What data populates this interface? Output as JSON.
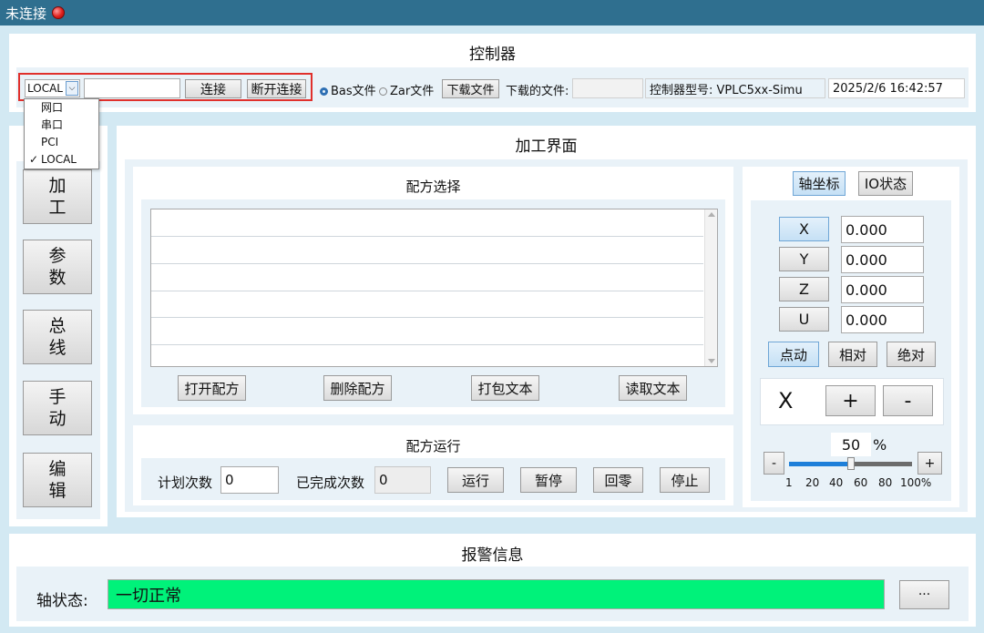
{
  "window": {
    "title": "未连接"
  },
  "controller": {
    "title": "控制器",
    "connection_type": "LOCAL",
    "address_value": "",
    "connect_label": "连接",
    "disconnect_label": "断开连接",
    "bas_label": "Bas文件",
    "zar_label": "Zar文件",
    "download_file_label": "下载文件",
    "downloaded_file_label": "下载的文件:",
    "downloaded_file_value": "",
    "model_label": "控制器型号: VPLC5xx-Simu",
    "datetime": "2025/2/6 16:42:57",
    "dropdown_options": [
      "网口",
      "串口",
      "PCI",
      "LOCAL"
    ],
    "dropdown_checked": "✓"
  },
  "sidebar": {
    "items": [
      {
        "line1": "加",
        "line2": "工"
      },
      {
        "line1": "参",
        "line2": "数"
      },
      {
        "line1": "总",
        "line2": "线"
      },
      {
        "line1": "手",
        "line2": "动"
      },
      {
        "line1": "编",
        "line2": "辑"
      }
    ]
  },
  "processing": {
    "title": "加工界面",
    "recipe_select": {
      "title": "配方选择",
      "open": "打开配方",
      "delete": "删除配方",
      "pack": "打包文本",
      "read": "读取文本"
    },
    "recipe_run": {
      "title": "配方运行",
      "plan_label": "计划次数",
      "plan_value": "0",
      "done_label": "已完成次数",
      "done_value": "0",
      "run": "运行",
      "pause": "暂停",
      "home": "回零",
      "stop": "停止"
    }
  },
  "axis_panel": {
    "tab_axis": "轴坐标",
    "tab_io": "IO状态",
    "axes": [
      {
        "name": "X",
        "value": "0.000"
      },
      {
        "name": "Y",
        "value": "0.000"
      },
      {
        "name": "Z",
        "value": "0.000"
      },
      {
        "name": "U",
        "value": "0.000"
      }
    ],
    "mode_jog": "点动",
    "mode_relative": "相对",
    "mode_absolute": "绝对",
    "jog_axis": "X",
    "plus": "+",
    "minus": "-",
    "speed_value": "50",
    "speed_unit": "%",
    "slider_minus": "-",
    "slider_plus": "+",
    "slider_level_percent": 50,
    "slider_ticks": [
      "1",
      "20",
      "40",
      "60",
      "80",
      "100%"
    ]
  },
  "alarm": {
    "title": "报警信息",
    "axis_status_label": "轴状态:",
    "axis_status_value": "一切正常",
    "status_color": "#00f27a",
    "more_label": "···"
  },
  "colors": {
    "accent": "#2f6f8f",
    "highlight_border": "#e0302c"
  }
}
